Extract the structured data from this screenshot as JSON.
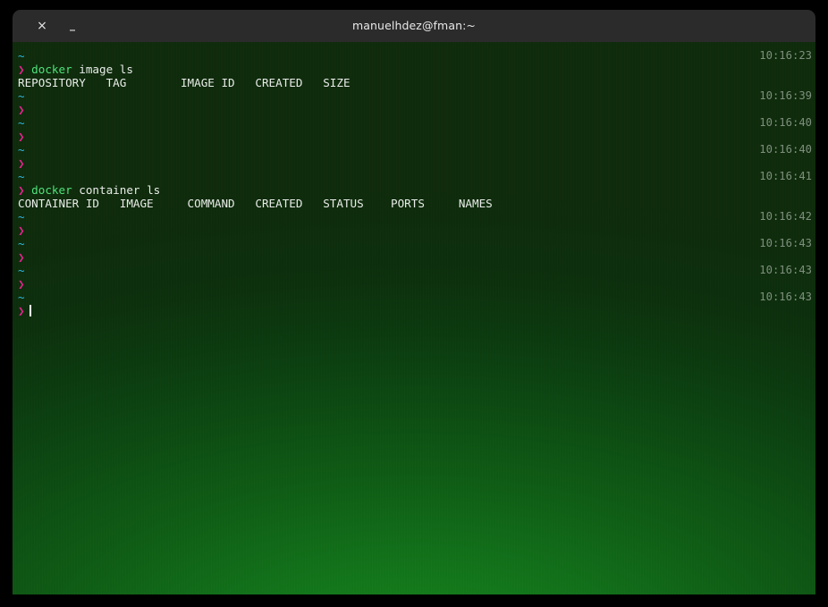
{
  "window": {
    "title": "manuelhdez@fman:~",
    "close_label": "×",
    "minimize_label": "–"
  },
  "terminal": {
    "prompt_symbol": "❯",
    "path_symbol": "~",
    "colors": {
      "path": "#2fb6e0",
      "prompt": "#e0248c",
      "command": "#4fe07a",
      "text": "#e9ece9",
      "timestamp": "#7e8f7e",
      "titlebar": "#2b2b2b",
      "background_top": "#0e2b0b",
      "background_bottom": "#17891a"
    },
    "lines": [
      {
        "kind": "path",
        "path": "~",
        "timestamp": "10:16:23"
      },
      {
        "kind": "command",
        "command": "docker",
        "args": " image ls",
        "timestamp": ""
      },
      {
        "kind": "output",
        "text": "REPOSITORY   TAG        IMAGE ID   CREATED   SIZE",
        "timestamp": ""
      },
      {
        "kind": "path",
        "path": "~",
        "timestamp": "10:16:39"
      },
      {
        "kind": "prompt",
        "timestamp": ""
      },
      {
        "kind": "path",
        "path": "~",
        "timestamp": "10:16:40"
      },
      {
        "kind": "prompt",
        "timestamp": ""
      },
      {
        "kind": "path",
        "path": "~",
        "timestamp": "10:16:40"
      },
      {
        "kind": "prompt",
        "timestamp": ""
      },
      {
        "kind": "path",
        "path": "~",
        "timestamp": "10:16:41"
      },
      {
        "kind": "command",
        "command": "docker",
        "args": " container ls",
        "timestamp": ""
      },
      {
        "kind": "output",
        "text": "CONTAINER ID   IMAGE     COMMAND   CREATED   STATUS    PORTS     NAMES",
        "timestamp": ""
      },
      {
        "kind": "path",
        "path": "~",
        "timestamp": "10:16:42"
      },
      {
        "kind": "prompt",
        "timestamp": ""
      },
      {
        "kind": "path",
        "path": "~",
        "timestamp": "10:16:43"
      },
      {
        "kind": "prompt",
        "timestamp": ""
      },
      {
        "kind": "path",
        "path": "~",
        "timestamp": "10:16:43"
      },
      {
        "kind": "prompt",
        "timestamp": ""
      },
      {
        "kind": "path",
        "path": "~",
        "timestamp": "10:16:43"
      },
      {
        "kind": "prompt",
        "cursor": true,
        "timestamp": ""
      }
    ]
  }
}
